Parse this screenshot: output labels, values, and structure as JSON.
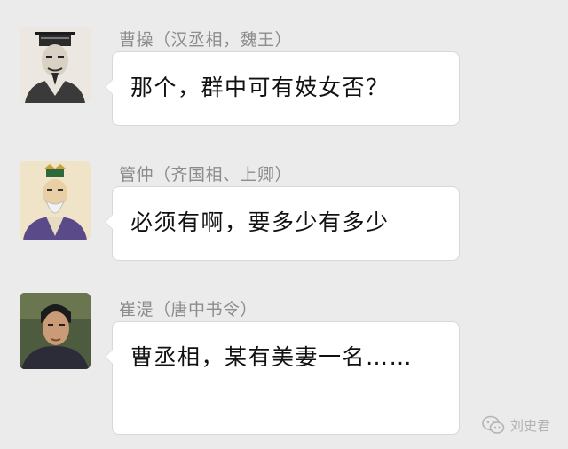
{
  "messages": [
    {
      "sender": "曹操（汉丞相，魏王）",
      "text": "那个，群中可有妓女否？",
      "avatar_icon": "cao-cao-portrait-icon"
    },
    {
      "sender": "管仲（齐国相、上卿）",
      "text": "必须有啊，要多少有多少",
      "avatar_icon": "guan-zhong-portrait-icon"
    },
    {
      "sender": "崔湜（唐中书令）",
      "text": "曹丞相，某有美妻一名……",
      "avatar_icon": "cui-shi-portrait-icon"
    }
  ],
  "watermark": {
    "text": "刘史君",
    "icon": "wechat-icon"
  },
  "colors": {
    "background": "#ebebeb",
    "bubble": "#ffffff",
    "sender_text": "#8c8c8c"
  }
}
